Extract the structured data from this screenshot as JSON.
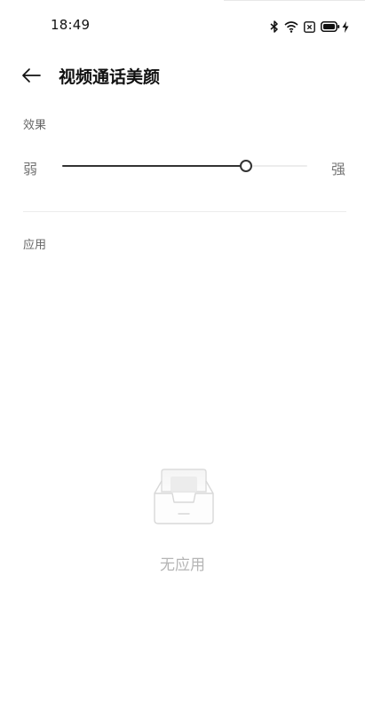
{
  "status_bar": {
    "time": "18:49",
    "icons": [
      "bluetooth-icon",
      "wifi-icon",
      "sim-disabled-icon",
      "battery-icon",
      "charging-icon"
    ]
  },
  "header": {
    "title": "视频通话美颜",
    "back_icon": "back-arrow-icon"
  },
  "effect": {
    "section_label": "效果",
    "min_label": "弱",
    "max_label": "强",
    "level": 0.75
  },
  "apps": {
    "section_label": "应用",
    "empty_text": "无应用",
    "empty_icon": "empty-tray-icon"
  }
}
